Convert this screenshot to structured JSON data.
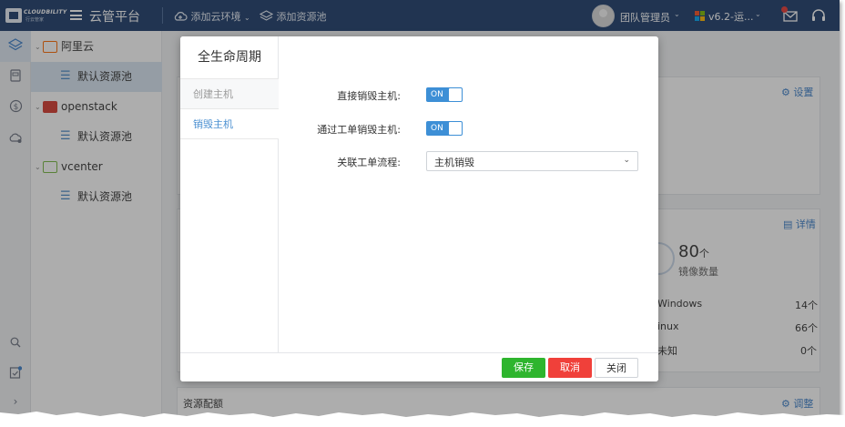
{
  "brand": {
    "logo_text": "CLOUDBILITY",
    "logo_subtext": "行云管家",
    "platform": "云管平台"
  },
  "topbar": {
    "add_cloud_env": "添加云环境",
    "add_resource_pool": "添加资源池",
    "user_label": "团队管理员",
    "version": "v6.2-运..."
  },
  "tree": {
    "nodes": [
      {
        "label": "阿里云",
        "children": [
          {
            "label": "默认资源池"
          }
        ]
      },
      {
        "label": "openstack",
        "children": [
          {
            "label": "默认资源池"
          }
        ]
      },
      {
        "label": "vcenter",
        "children": [
          {
            "label": "默认资源池"
          }
        ]
      }
    ]
  },
  "background": {
    "settings_link": "设置",
    "details_link": "详情",
    "image_count": "80",
    "image_count_unit": "个",
    "image_count_label": "镜像数量",
    "os_rows": [
      {
        "name": "Windows",
        "count": "14",
        "unit": "个"
      },
      {
        "name": "inux",
        "count": "66",
        "unit": "个"
      },
      {
        "name": "未知",
        "count": "0",
        "unit": "个"
      }
    ],
    "quota_title": "资源配额",
    "adjust_link": "调整"
  },
  "modal": {
    "title": "全生命周期",
    "nav": [
      {
        "label": "创建主机"
      },
      {
        "label": "销毁主机"
      }
    ],
    "form": {
      "direct_destroy_label": "直接销毁主机:",
      "direct_destroy_value": "ON",
      "ticket_destroy_label": "通过工单销毁主机:",
      "ticket_destroy_value": "ON",
      "workflow_label": "关联工单流程:",
      "workflow_value": "主机销毁"
    },
    "footer": {
      "save": "保存",
      "cancel": "取消",
      "close": "关闭"
    }
  },
  "colors": {
    "topbar": "#1d3d6b",
    "accent": "#3d8fd6",
    "save": "#2eb52e",
    "cancel": "#f0403a"
  }
}
